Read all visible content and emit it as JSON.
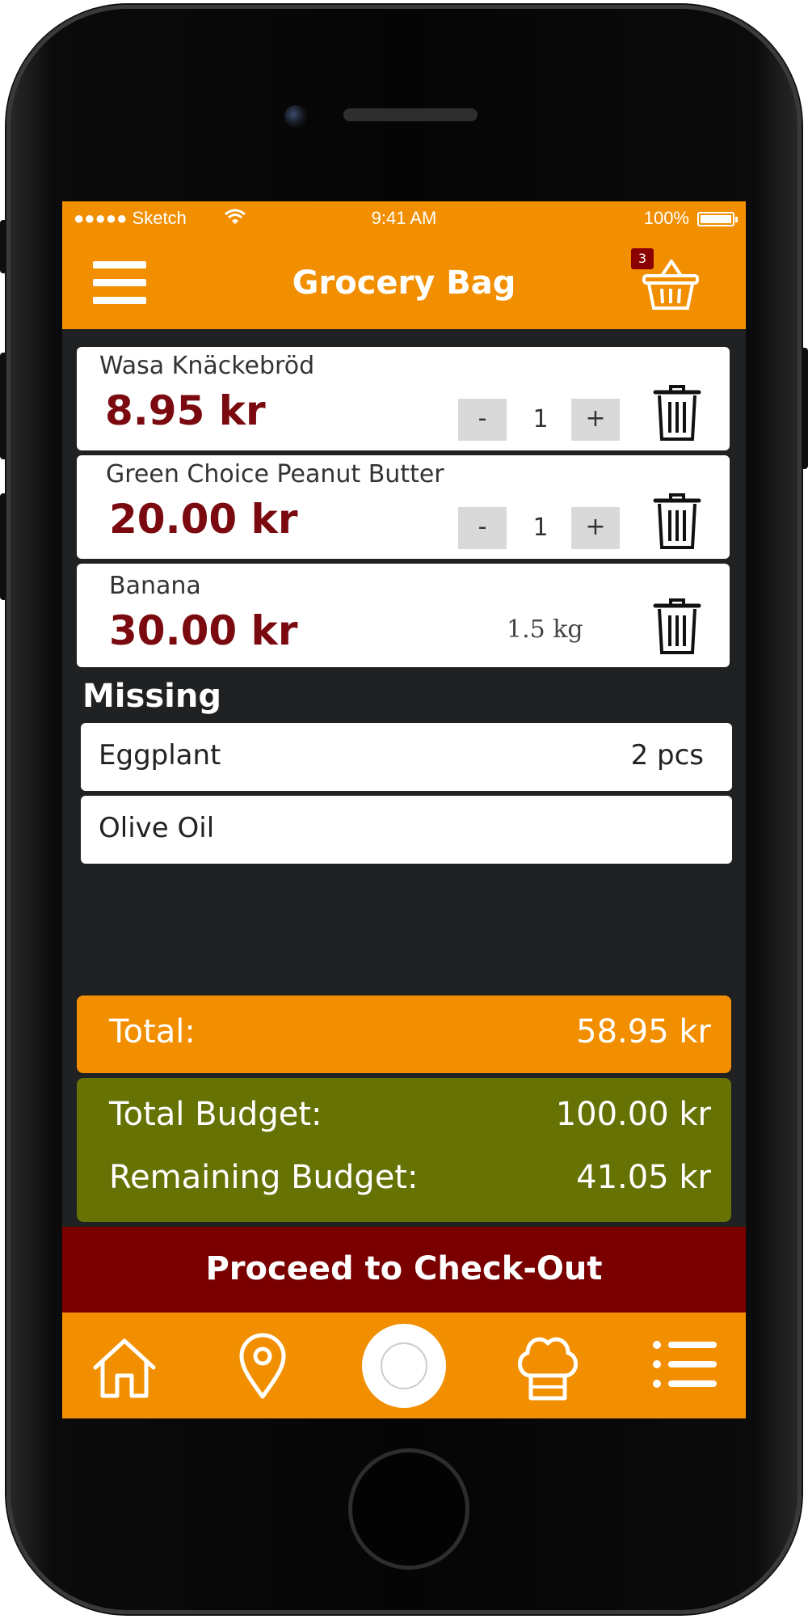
{
  "status_bar": {
    "carrier": "●●●●● Sketch",
    "time": "9:41 AM",
    "battery": "100%"
  },
  "header": {
    "title": "Grocery Bag",
    "cart_count": "3"
  },
  "items": [
    {
      "name": "Wasa Knäckebröd",
      "price": "8.95 kr",
      "qty_minus": "-",
      "qty": "1",
      "qty_plus": "+"
    },
    {
      "name": "Green Choice Peanut Butter",
      "price": "20.00 kr",
      "qty_minus": "-",
      "qty": "1",
      "qty_plus": "+"
    },
    {
      "name": "Banana",
      "price": "30.00 kr",
      "weight": "1.5 kg"
    }
  ],
  "missing": {
    "title": "Missing",
    "items": [
      {
        "name": "Eggplant",
        "qty": "2 pcs"
      },
      {
        "name": "Olive Oil",
        "qty": ""
      }
    ]
  },
  "totals": {
    "total_label": "Total:",
    "total_value": "58.95 kr",
    "budget_label": "Total Budget:",
    "budget_value": "100.00 kr",
    "remaining_label": "Remaining Budget:",
    "remaining_value": "41.05 kr"
  },
  "checkout": {
    "label": "Proceed to Check-Out"
  },
  "tabs": [
    "home-icon",
    "location-pin-icon",
    "plate-icon",
    "chef-hat-icon",
    "list-icon"
  ],
  "colors": {
    "orange": "#f28f00",
    "dark_red": "#7a0000",
    "olive": "#667204",
    "price_red": "#7a0a0f"
  }
}
